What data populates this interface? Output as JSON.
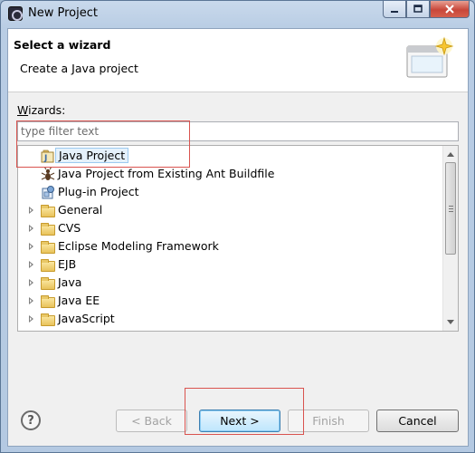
{
  "window": {
    "title": "New Project"
  },
  "banner": {
    "title": "Select a wizard",
    "description": "Create a Java project"
  },
  "wizards": {
    "label_prefix": "W",
    "label_rest": "izards:"
  },
  "filter": {
    "placeholder": "type filter text",
    "value": ""
  },
  "tree": {
    "items": [
      {
        "label": "Java Project",
        "icon": "java-project-icon",
        "expandable": false,
        "selected": true
      },
      {
        "label": "Java Project from Existing Ant Buildfile",
        "icon": "ant-icon",
        "expandable": false,
        "selected": false
      },
      {
        "label": "Plug-in Project",
        "icon": "plugin-icon",
        "expandable": false,
        "selected": false
      },
      {
        "label": "General",
        "icon": "folder-icon",
        "expandable": true,
        "selected": false
      },
      {
        "label": "CVS",
        "icon": "folder-icon",
        "expandable": true,
        "selected": false
      },
      {
        "label": "Eclipse Modeling Framework",
        "icon": "folder-icon",
        "expandable": true,
        "selected": false
      },
      {
        "label": "EJB",
        "icon": "folder-icon",
        "expandable": true,
        "selected": false
      },
      {
        "label": "Java",
        "icon": "folder-icon",
        "expandable": true,
        "selected": false
      },
      {
        "label": "Java EE",
        "icon": "folder-icon",
        "expandable": true,
        "selected": false
      },
      {
        "label": "JavaScript",
        "icon": "folder-icon",
        "expandable": true,
        "selected": false
      }
    ]
  },
  "buttons": {
    "help": "?",
    "back": "< Back",
    "next": "Next >",
    "finish": "Finish",
    "cancel": "Cancel"
  },
  "colors": {
    "highlight_box": "#d9534f",
    "selection": "#e5f1fb"
  }
}
